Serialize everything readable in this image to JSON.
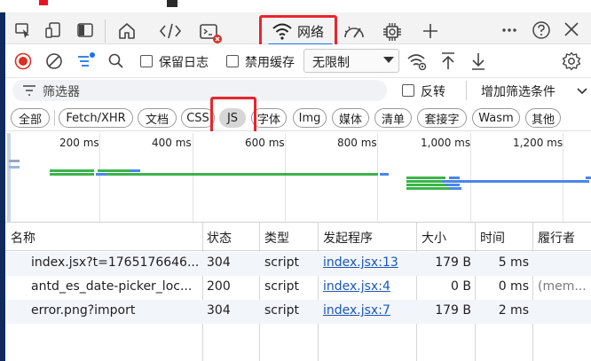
{
  "tabs": {
    "network_label": "网络"
  },
  "toolbar": {
    "preserve_log": "保留日志",
    "disable_cache": "禁用缓存",
    "throttle_value": "无限制"
  },
  "filter": {
    "placeholder": "筛选器",
    "invert": "反转",
    "more_filters": "增加筛选条件"
  },
  "type_filters": [
    "全部",
    "Fetch/XHR",
    "文档",
    "CSS",
    "JS",
    "字体",
    "Img",
    "媒体",
    "清单",
    "套接字",
    "Wasm",
    "其他"
  ],
  "timeline": {
    "ticks": [
      "200 ms",
      "400 ms",
      "600 ms",
      "800 ms",
      "1,000 ms",
      "1,200 ms"
    ]
  },
  "table": {
    "headers": [
      "名称",
      "状态",
      "类型",
      "发起程序",
      "大小",
      "时间",
      "履行者"
    ],
    "rows": [
      {
        "name": "index.jsx?t=1765176646...",
        "status": "304",
        "type": "script",
        "initiator": "index.jsx:13",
        "size": "179 B",
        "time": "5 ms",
        "fulfilled": ""
      },
      {
        "name": "antd_es_date-picker_loc...",
        "status": "200",
        "type": "script",
        "initiator": "index.jsx:4",
        "size": "0 B",
        "time": "0 ms",
        "fulfilled": "(mem..."
      },
      {
        "name": "error.png?import",
        "status": "304",
        "type": "script",
        "initiator": "index.jsx:7",
        "size": "179 B",
        "time": "2 ms",
        "fulfilled": ""
      }
    ]
  },
  "colors": {
    "accent": "#1a73e8",
    "highlight_red": "#e8262d",
    "waterfall_green": "#3cb44b",
    "waterfall_blue": "#4a86e8"
  }
}
